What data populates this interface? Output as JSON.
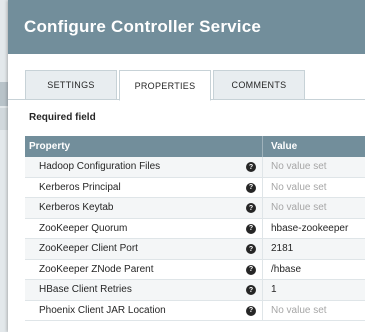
{
  "dialog": {
    "title": "Configure Controller Service",
    "tabs": [
      {
        "label": "SETTINGS"
      },
      {
        "label": "PROPERTIES"
      },
      {
        "label": "COMMENTS"
      }
    ],
    "required_note": "Required field",
    "table": {
      "headers": {
        "property": "Property",
        "value": "Value"
      },
      "rows": [
        {
          "property": "Hadoop Configuration Files",
          "value": "No value set"
        },
        {
          "property": "Kerberos Principal",
          "value": "No value set"
        },
        {
          "property": "Kerberos Keytab",
          "value": "No value set"
        },
        {
          "property": "ZooKeeper Quorum",
          "value": "hbase-zookeeper"
        },
        {
          "property": "ZooKeeper Client Port",
          "value": "2181"
        },
        {
          "property": "ZooKeeper ZNode Parent",
          "value": "/hbase"
        },
        {
          "property": "HBase Client Retries",
          "value": "1"
        },
        {
          "property": "Phoenix Client JAR Location",
          "value": "No value set"
        }
      ]
    }
  },
  "icons": {
    "help": "question-mark-icon"
  },
  "colors": {
    "header": "#728e9b",
    "empty_value": "#a6a6a6"
  }
}
